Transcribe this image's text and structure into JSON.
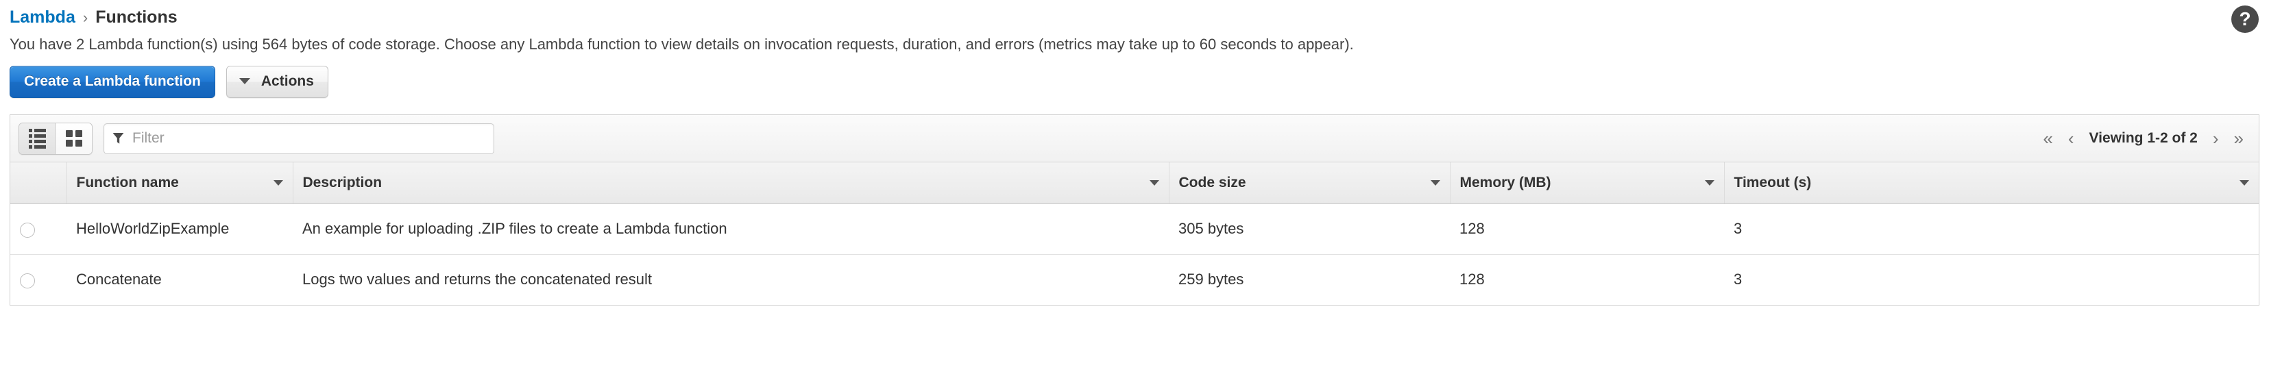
{
  "breadcrumb": {
    "root": "Lambda",
    "separator": "›",
    "current": "Functions"
  },
  "help_icon": "?",
  "intro_text": "You have 2 Lambda function(s) using 564 bytes of code storage. Choose any Lambda function to view details on invocation requests, duration, and errors (metrics may take up to 60 seconds to appear).",
  "actions": {
    "create_label": "Create a Lambda function",
    "actions_label": "Actions"
  },
  "toolbar": {
    "view_list_icon": "list-view-icon",
    "view_grid_icon": "grid-view-icon",
    "filter_placeholder": "Filter",
    "filter_value": "",
    "filter_icon": "funnel-icon"
  },
  "pagination": {
    "first": "«",
    "prev": "‹",
    "label": "Viewing 1-2 of 2",
    "next": "›",
    "last": "»"
  },
  "table": {
    "columns": [
      {
        "key": "select",
        "label": ""
      },
      {
        "key": "name",
        "label": "Function name"
      },
      {
        "key": "description",
        "label": "Description"
      },
      {
        "key": "codesize",
        "label": "Code size"
      },
      {
        "key": "memory",
        "label": "Memory (MB)"
      },
      {
        "key": "timeout",
        "label": "Timeout (s)"
      }
    ],
    "rows": [
      {
        "name": "HelloWorldZipExample",
        "description": "An example for uploading .ZIP files to create a Lambda function",
        "codesize": "305 bytes",
        "memory": "128",
        "timeout": "3"
      },
      {
        "name": "Concatenate",
        "description": "Logs two values and returns the concatenated result",
        "codesize": "259 bytes",
        "memory": "128",
        "timeout": "3"
      }
    ]
  },
  "colors": {
    "link": "#0073bb",
    "primary_button": "#1a6dc4",
    "text": "#333333",
    "panel_border": "#cfcfcf"
  }
}
